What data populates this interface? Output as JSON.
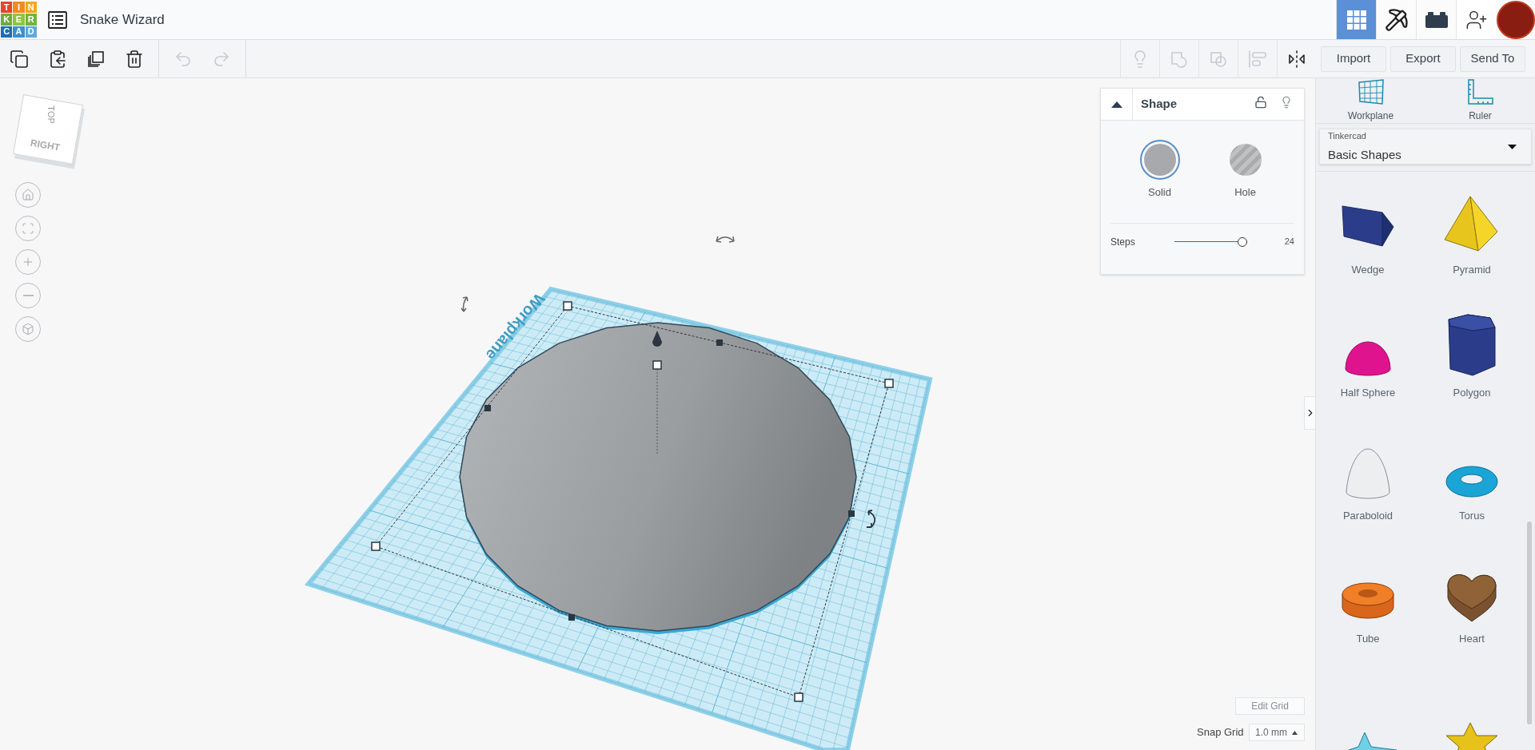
{
  "header": {
    "logo_letters": [
      "T",
      "I",
      "N",
      "K",
      "E",
      "R",
      "C",
      "A",
      "D"
    ],
    "title": "Snake Wizard",
    "views": [
      {
        "kind": "grid",
        "selected": true
      },
      {
        "kind": "blocks",
        "selected": false
      },
      {
        "kind": "bricks",
        "selected": false
      }
    ]
  },
  "toolbar": {
    "left_tools": [
      {
        "kind": "copy",
        "disabled": false
      },
      {
        "kind": "paste",
        "disabled": false
      },
      {
        "kind": "duplicate",
        "disabled": false
      },
      {
        "kind": "delete",
        "disabled": false
      },
      {
        "kind": "undo",
        "disabled": true
      },
      {
        "kind": "redo",
        "disabled": true
      }
    ],
    "right_tools": [
      {
        "kind": "hide",
        "disabled": true
      },
      {
        "kind": "group",
        "disabled": true
      },
      {
        "kind": "ungroup",
        "disabled": true
      },
      {
        "kind": "align",
        "disabled": true
      },
      {
        "kind": "mirror",
        "disabled": false
      }
    ],
    "buttons": [
      "Import",
      "Export",
      "Send To"
    ]
  },
  "view_cube": {
    "top": "TOP",
    "right": "RIGHT"
  },
  "nav_buttons": [
    {
      "kind": "home"
    },
    {
      "kind": "fit"
    },
    {
      "kind": "zoom-in"
    },
    {
      "kind": "zoom-out"
    },
    {
      "kind": "ortho"
    }
  ],
  "canvas": {
    "workplane_label": "Workplane"
  },
  "shape_panel": {
    "title": "Shape",
    "locked": false,
    "modes": [
      {
        "label": "Solid",
        "kind": "solid",
        "selected": true
      },
      {
        "label": "Hole",
        "kind": "hole",
        "selected": false
      }
    ],
    "steps": {
      "label": "Steps",
      "level": 0.97,
      "value": "24"
    }
  },
  "grid_controls": {
    "edit_grid": "Edit Grid",
    "snap_label": "Snap Grid",
    "snap_value": "1.0 mm"
  },
  "sidebar": {
    "tools": [
      {
        "kind": "workplane",
        "label": "Workplane"
      },
      {
        "kind": "ruler",
        "label": "Ruler"
      }
    ],
    "library": {
      "label": "Tinkercad",
      "value": "Basic Shapes"
    },
    "shapes": [
      {
        "kind": "wedge",
        "label": "Wedge"
      },
      {
        "kind": "pyramid",
        "label": "Pyramid"
      },
      {
        "kind": "half-sphere",
        "label": "Half Sphere"
      },
      {
        "kind": "polygon",
        "label": "Polygon"
      },
      {
        "kind": "paraboloid",
        "label": "Paraboloid"
      },
      {
        "kind": "torus",
        "label": "Torus"
      },
      {
        "kind": "tube",
        "label": "Tube"
      },
      {
        "kind": "heart",
        "label": "Heart"
      },
      {
        "kind": "star-pyramid"
      },
      {
        "kind": "star"
      }
    ]
  }
}
